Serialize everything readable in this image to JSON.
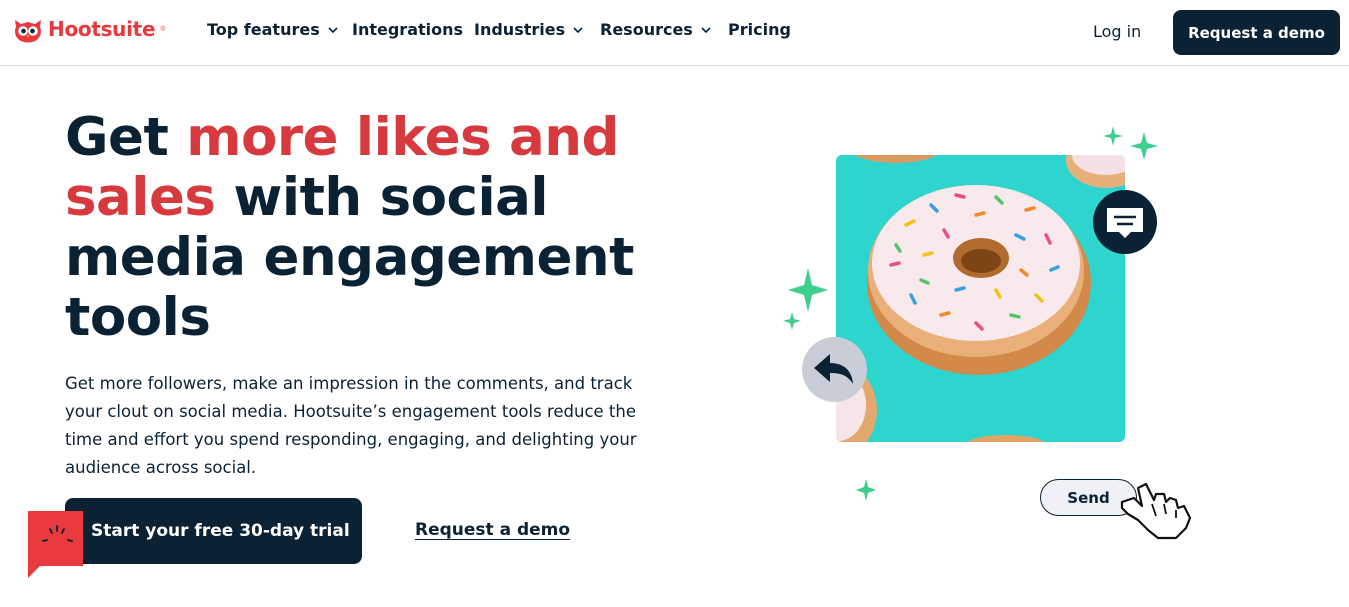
{
  "brand": {
    "name": "Hootsuite",
    "color": "#e8393e"
  },
  "nav": {
    "items": [
      {
        "label": "Top features",
        "has_dropdown": true
      },
      {
        "label": "Integrations",
        "has_dropdown": false
      },
      {
        "label": "Industries",
        "has_dropdown": true
      },
      {
        "label": "Resources",
        "has_dropdown": true
      },
      {
        "label": "Pricing",
        "has_dropdown": false
      }
    ],
    "login_label": "Log in",
    "demo_label": "Request a demo"
  },
  "hero": {
    "title_accent_1": "more likes and",
    "title_accent_2": "sales",
    "title_line1_start": "Get ",
    "title_line2_rest": " with social",
    "title_line3": "media engagement",
    "title_line4": "tools",
    "description": "Get more followers, make an impression in the comments, and track your clout on social media. Hootsuite’s engagement tools reduce the time and effort you spend responding, engaging, and delighting your audience across social.",
    "cta_primary": "Start your free 30-day trial",
    "cta_secondary": "Request a demo"
  },
  "illustration": {
    "send_label": "Send",
    "icons": [
      "sparkle-icon",
      "chat-bubble-icon",
      "reply-arrow-icon",
      "pointer-hand-icon",
      "donut-image"
    ]
  },
  "colors": {
    "navy": "#0b2234",
    "accent_red": "#d63a3f",
    "teal": "#2ed5cf",
    "sparkle_green": "#3ecf8e"
  }
}
